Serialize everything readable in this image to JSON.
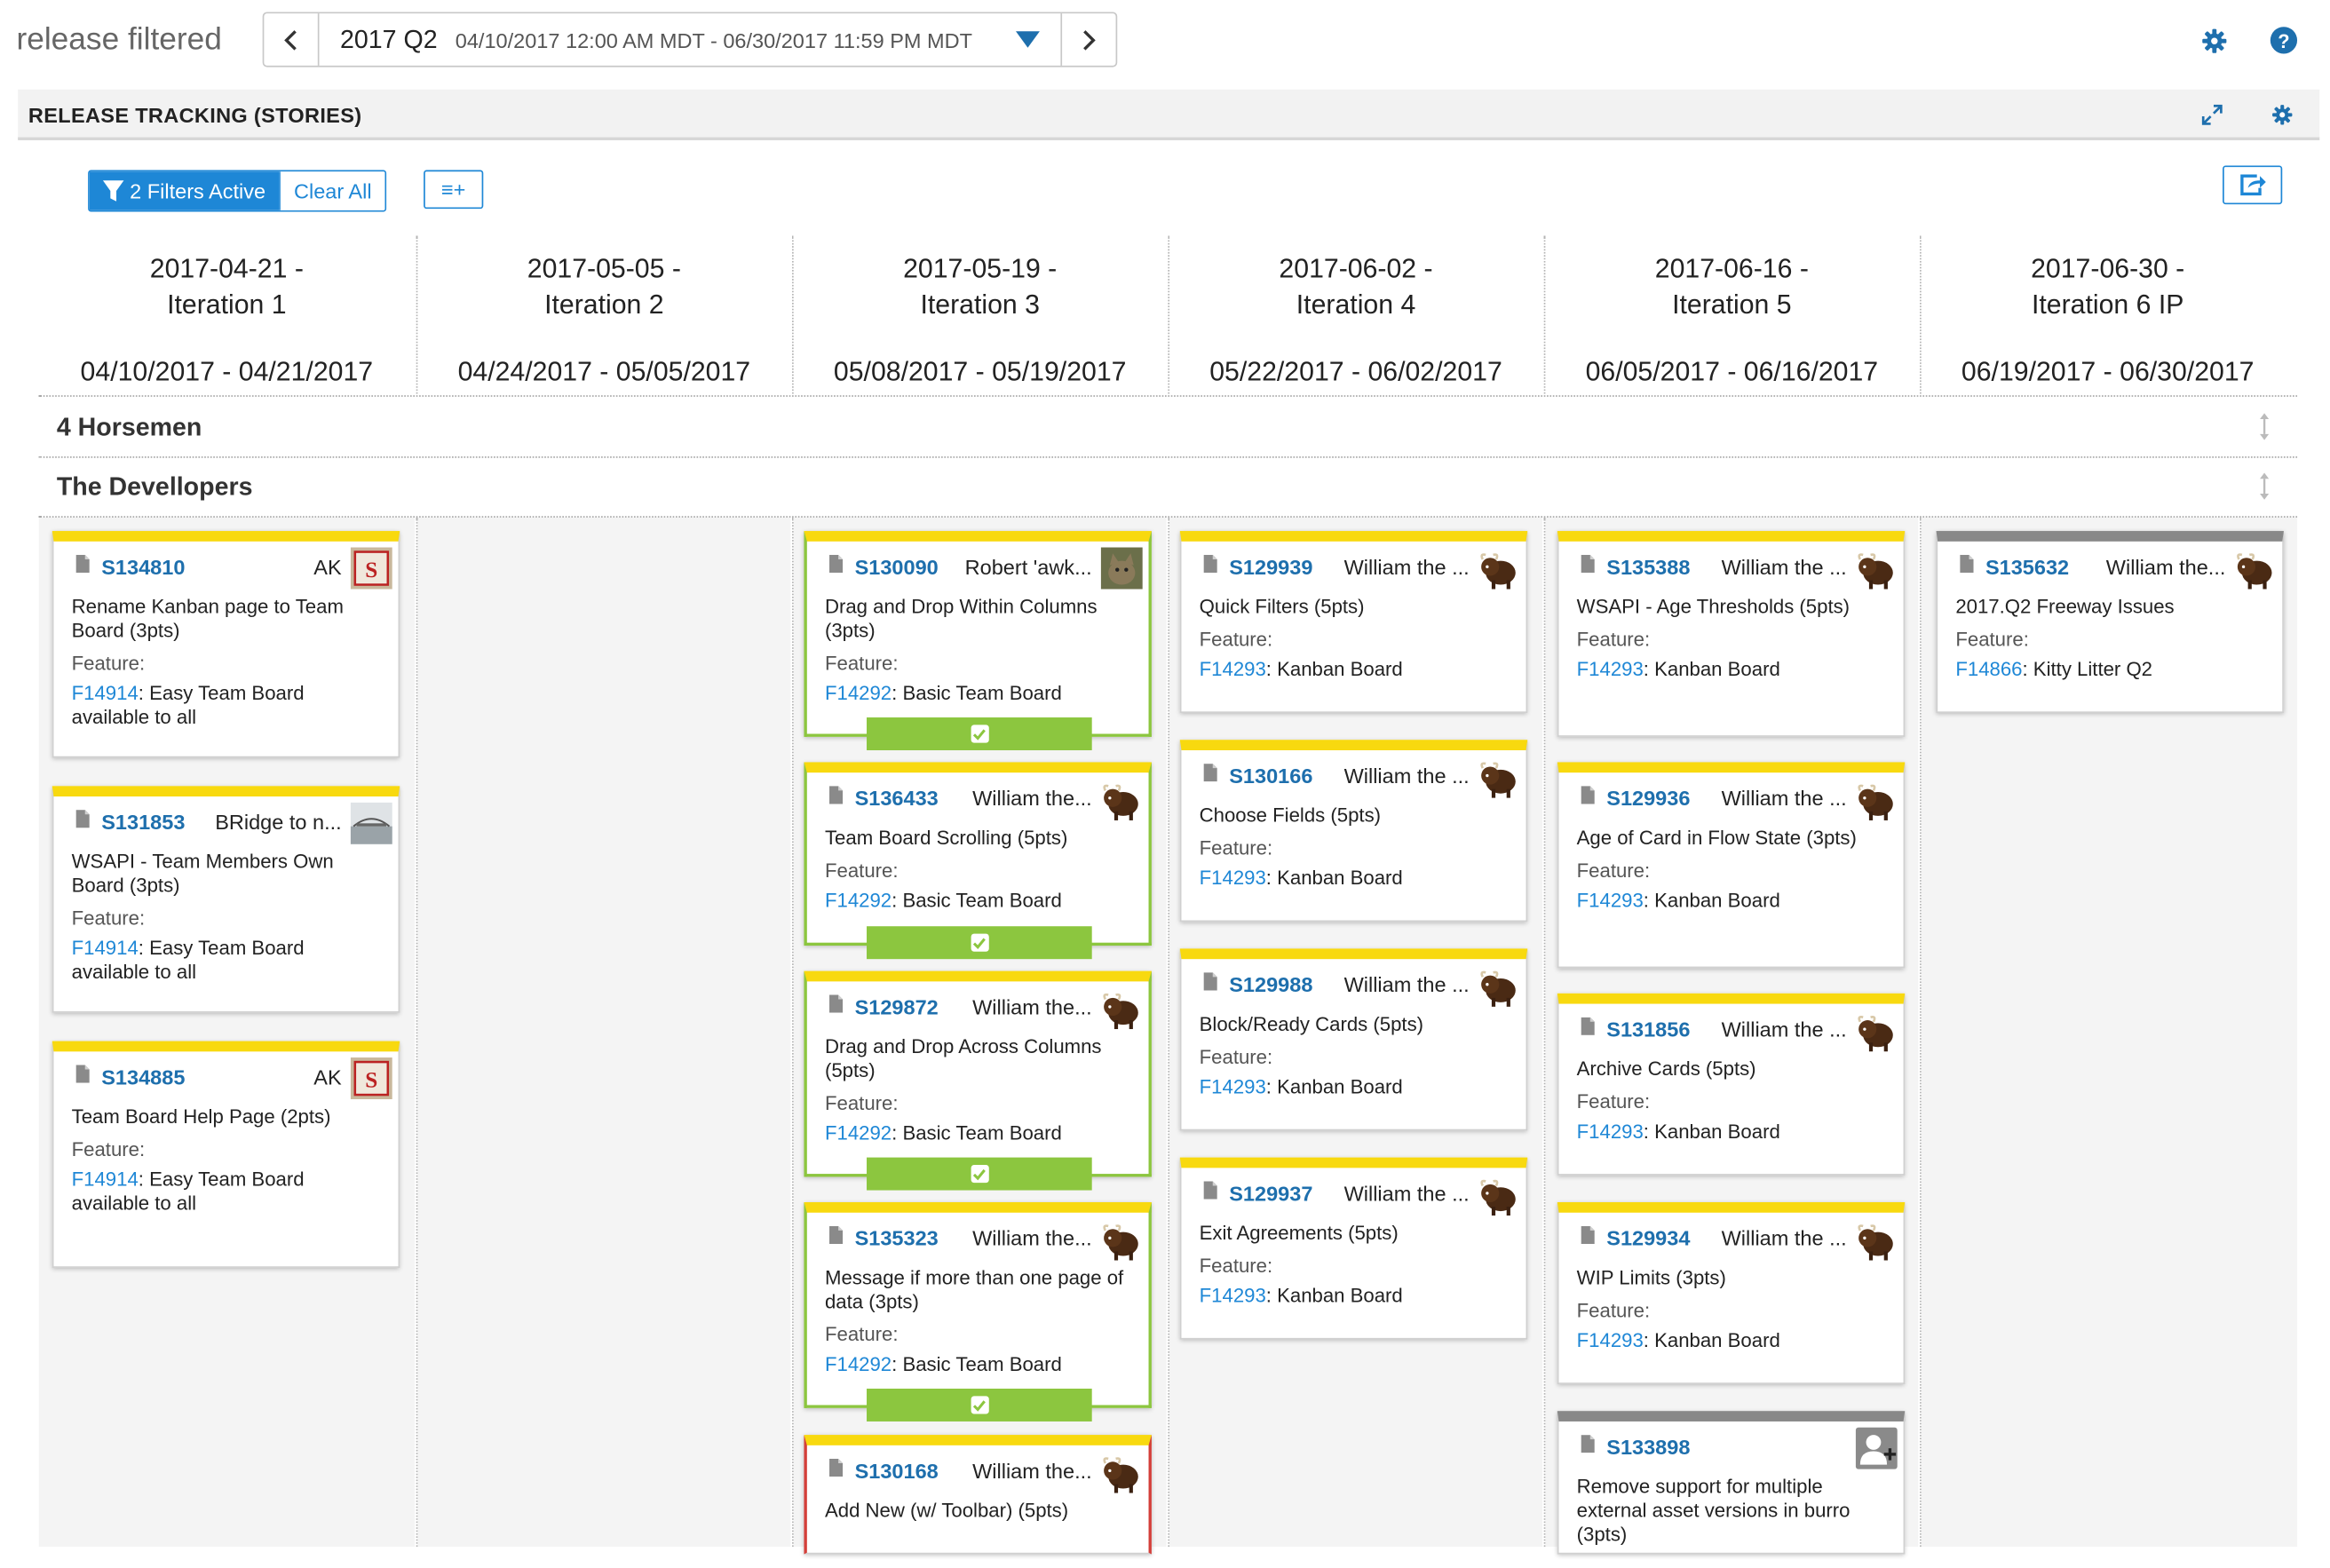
{
  "app": {
    "title": "release filtered"
  },
  "release_picker": {
    "name": "2017 Q2",
    "range": "04/10/2017 12:00 AM MDT - 06/30/2017 11:59 PM MDT",
    "prev_icon": "chevron-left-icon",
    "next_icon": "chevron-right-icon"
  },
  "panel": {
    "title": "RELEASE TRACKING (STORIES)"
  },
  "toolbar": {
    "filters_label": "2 Filters Active",
    "clear_label": "Clear All",
    "fields_label": "≡+"
  },
  "colors": {
    "accent": "#1e87d6",
    "link": "#1e6fad",
    "ready": "#8cc63f",
    "card_top": "#f8d90f",
    "blocked": "#d43f3a"
  },
  "iterations": [
    {
      "title": "2017-04-21 -",
      "name": "Iteration 1",
      "dates": "04/10/2017 - 04/21/2017"
    },
    {
      "title": "2017-05-05 -",
      "name": "Iteration 2",
      "dates": "04/24/2017 - 05/05/2017"
    },
    {
      "title": "2017-05-19 -",
      "name": "Iteration 3",
      "dates": "05/08/2017 - 05/19/2017"
    },
    {
      "title": "2017-06-02 -",
      "name": "Iteration 4",
      "dates": "05/22/2017 - 06/02/2017"
    },
    {
      "title": "2017-06-16 -",
      "name": "Iteration 5",
      "dates": "06/05/2017 - 06/16/2017"
    },
    {
      "title": "2017-06-30 -",
      "name": "Iteration 6 IP",
      "dates": "06/19/2017 - 06/30/2017"
    }
  ],
  "swimlanes": [
    {
      "name": "4 Horsemen"
    },
    {
      "name": "The Devellopers"
    }
  ],
  "feature_label": "Feature:",
  "cards": [
    {
      "id": "S134810",
      "owner": "AK",
      "avatar": "cardinals-logo",
      "name": "Rename Kanban page to Team Board (3pts)",
      "feature_id": "F14914",
      "feature_name": ": Easy Team Board available to all"
    },
    {
      "id": "S131853",
      "owner": "BRidge to n...",
      "avatar": "bridge-photo",
      "name": "WSAPI - Team Members Own Board (3pts)",
      "feature_id": "F14914",
      "feature_name": ": Easy Team Board available to all"
    },
    {
      "id": "S134885",
      "owner": "AK",
      "avatar": "cardinals-logo",
      "name": "Team Board Help Page (2pts)",
      "feature_id": "F14914",
      "feature_name": ": Easy Team Board available to all"
    },
    {
      "id": "S130090",
      "owner": "Robert 'awk...",
      "avatar": "cat-photo",
      "name": "Drag and Drop Within Columns (3pts)",
      "feature_id": "F14292",
      "feature_name": ": Basic Team Board",
      "ready": true
    },
    {
      "id": "S136433",
      "owner": "William the...",
      "avatar": "yak",
      "name": "Team Board Scrolling (5pts)",
      "feature_id": "F14292",
      "feature_name": ": Basic Team Board",
      "ready": true
    },
    {
      "id": "S129872",
      "owner": "William the...",
      "avatar": "yak",
      "name": "Drag and Drop Across Columns (5pts)",
      "feature_id": "F14292",
      "feature_name": ": Basic Team Board",
      "ready": true
    },
    {
      "id": "S135323",
      "owner": "William the...",
      "avatar": "yak",
      "name": "Message if more than one page of data (3pts)",
      "feature_id": "F14292",
      "feature_name": ": Basic Team Board",
      "ready": true
    },
    {
      "id": "S130168",
      "owner": "William the...",
      "avatar": "yak",
      "name": "Add New (w/ Toolbar) (5pts)",
      "blocked": true
    },
    {
      "id": "S129939",
      "owner": "William the ...",
      "avatar": "yak",
      "name": "Quick Filters (5pts)",
      "feature_id": "F14293",
      "feature_name": ": Kanban Board"
    },
    {
      "id": "S130166",
      "owner": "William the ...",
      "avatar": "yak",
      "name": "Choose Fields (5pts)",
      "feature_id": "F14293",
      "feature_name": ": Kanban Board"
    },
    {
      "id": "S129988",
      "owner": "William the ...",
      "avatar": "yak",
      "name": "Block/Ready Cards (5pts)",
      "feature_id": "F14293",
      "feature_name": ": Kanban Board"
    },
    {
      "id": "S129937",
      "owner": "William the ...",
      "avatar": "yak",
      "name": "Exit Agreements (5pts)",
      "feature_id": "F14293",
      "feature_name": ": Kanban Board"
    },
    {
      "id": "S135388",
      "owner": "William the ...",
      "avatar": "yak",
      "name": "WSAPI - Age Thresholds (5pts)",
      "feature_id": "F14293",
      "feature_name": ": Kanban Board"
    },
    {
      "id": "S129936",
      "owner": "William the ...",
      "avatar": "yak",
      "name": "Age of Card in Flow State (3pts)",
      "feature_id": "F14293",
      "feature_name": ": Kanban Board"
    },
    {
      "id": "S131856",
      "owner": "William the ...",
      "avatar": "yak",
      "name": "Archive Cards (5pts)",
      "feature_id": "F14293",
      "feature_name": ": Kanban Board"
    },
    {
      "id": "S129934",
      "owner": "William the ...",
      "avatar": "yak",
      "name": "WIP Limits (3pts)",
      "feature_id": "F14293",
      "feature_name": ": Kanban Board"
    },
    {
      "id": "S133898",
      "owner": "",
      "avatar": "add-user",
      "name": "Remove support for multiple external asset versions in burro (3pts)"
    },
    {
      "id": "S135632",
      "owner": "William the...",
      "avatar": "yak",
      "name": "2017.Q2 Freeway Issues",
      "feature_id": "F14866",
      "feature_name": ": Kitty Litter Q2"
    }
  ]
}
